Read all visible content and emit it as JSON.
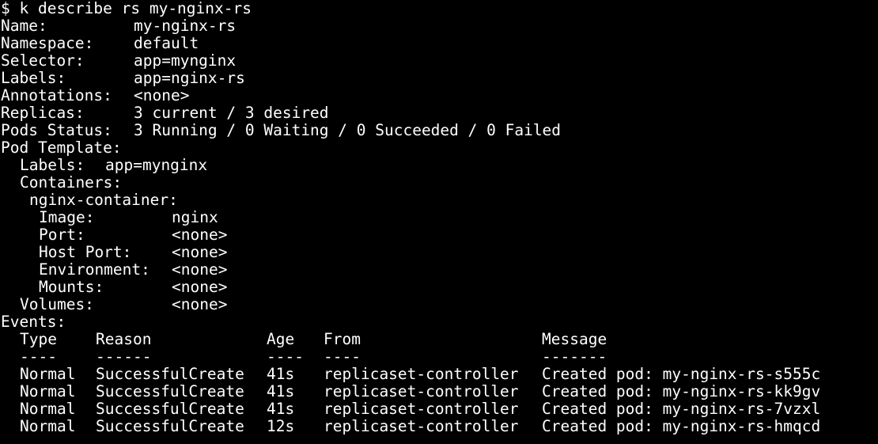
{
  "terminal": {
    "background": "#000000",
    "foreground": "#ffffff",
    "prompt_line": "$ k describe rs my-nginx-rs",
    "fields": [
      {
        "label": "Name:",
        "value": "my-nginx-rs"
      },
      {
        "label": "Namespace:",
        "value": "default"
      },
      {
        "label": "Selector:",
        "value": "app=mynginx"
      },
      {
        "label": "Labels:",
        "value": "app=nginx-rs"
      },
      {
        "label": "Annotations:",
        "value": "<none>"
      },
      {
        "label": "Replicas:",
        "value": "3 current / 3 desired"
      },
      {
        "label": "Pods Status:",
        "value": "3 Running / 0 Waiting / 0 Succeeded / 0 Failed"
      }
    ],
    "pod_template": {
      "heading": "Pod Template:",
      "labels_label": "Labels:",
      "labels_value": "app=mynginx",
      "containers_label": "Containers:",
      "container_name": "nginx-container:",
      "container_fields": [
        {
          "label": "Image:",
          "value": "nginx"
        },
        {
          "label": "Port:",
          "value": "<none>"
        },
        {
          "label": "Host Port:",
          "value": "<none>"
        },
        {
          "label": "Environment:",
          "value": "<none>"
        },
        {
          "label": "Mounts:",
          "value": "<none>"
        }
      ],
      "volumes_label": "Volumes:",
      "volumes_value": "<none>"
    },
    "events": {
      "heading": "Events:",
      "columns": {
        "type": "Type",
        "reason": "Reason",
        "age": "Age",
        "from": "From",
        "message": "Message"
      },
      "underlines": {
        "type": "----",
        "reason": "------",
        "age": "----",
        "from": "----",
        "message": "-------"
      },
      "rows": [
        {
          "type": "Normal",
          "reason": "SuccessfulCreate",
          "age": "41s",
          "from": "replicaset-controller",
          "message": "Created pod: my-nginx-rs-s555c"
        },
        {
          "type": "Normal",
          "reason": "SuccessfulCreate",
          "age": "41s",
          "from": "replicaset-controller",
          "message": "Created pod: my-nginx-rs-kk9gv"
        },
        {
          "type": "Normal",
          "reason": "SuccessfulCreate",
          "age": "41s",
          "from": "replicaset-controller",
          "message": "Created pod: my-nginx-rs-7vzxl"
        },
        {
          "type": "Normal",
          "reason": "SuccessfulCreate",
          "age": "12s",
          "from": "replicaset-controller",
          "message": "Created pod: my-nginx-rs-hmqcd"
        }
      ]
    }
  }
}
